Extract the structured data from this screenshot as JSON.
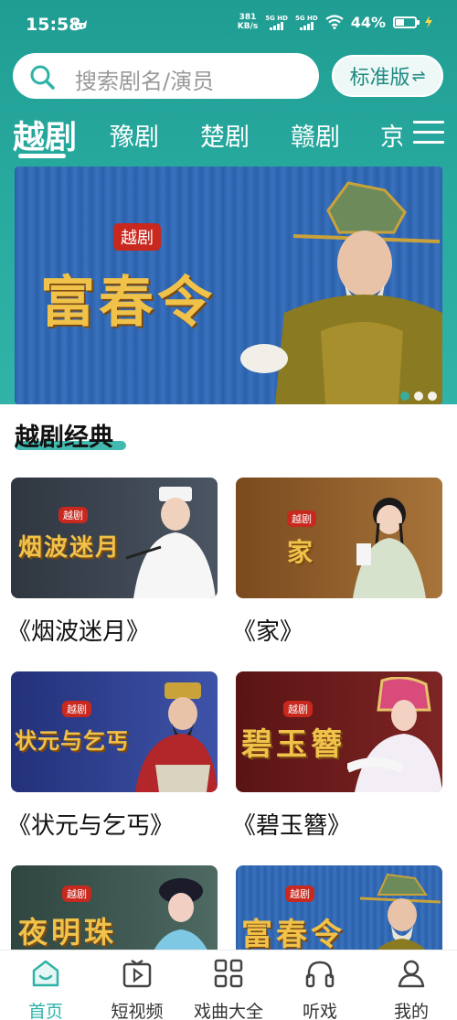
{
  "status_bar": {
    "time": "15:58",
    "net_speed_value": "381",
    "net_speed_unit": "KB/s",
    "signal1_label": "5G HD",
    "signal2_label": "5G HD",
    "battery_percent": "44%",
    "battery_level": 0.44
  },
  "search": {
    "placeholder": "搜索剧名/演员",
    "icon": "search-icon"
  },
  "edition_button": {
    "label": "标准版",
    "icon": "swap-icon"
  },
  "category_tabs": [
    {
      "label": "越剧",
      "active": true
    },
    {
      "label": "豫剧",
      "active": false
    },
    {
      "label": "楚剧",
      "active": false
    },
    {
      "label": "赣剧",
      "active": false
    },
    {
      "label": "京",
      "active": false
    }
  ],
  "banner": {
    "tag": "越剧",
    "title": "富春令",
    "dot_count": 3,
    "active_dot": 0
  },
  "section": {
    "title": "越剧经典"
  },
  "cards": [
    {
      "title": "《烟波迷月》",
      "tag": "越剧",
      "calligraphy": "烟波迷月",
      "bg": "#3c4450"
    },
    {
      "title": "《家》",
      "tag": "越剧",
      "calligraphy": "家",
      "bg": "#8a5a2a"
    },
    {
      "title": "《状元与乞丐》",
      "tag": "越剧",
      "calligraphy": "状元与乞丐",
      "bg": "#2e3f8c"
    },
    {
      "title": "《碧玉簪》",
      "tag": "越剧",
      "calligraphy": "碧玉簪",
      "bg": "#6a1b1b"
    },
    {
      "title": "",
      "tag": "越剧",
      "calligraphy": "夜明珠",
      "bg": "#35504a"
    },
    {
      "title": "",
      "tag": "越剧",
      "calligraphy": "富春令",
      "bg": "#2c5ea8"
    }
  ],
  "bottom_nav": [
    {
      "label": "首页",
      "icon": "home-icon",
      "active": true
    },
    {
      "label": "短视频",
      "icon": "video-icon",
      "active": false
    },
    {
      "label": "戏曲大全",
      "icon": "grid-icon",
      "active": false
    },
    {
      "label": "听戏",
      "icon": "headphones-icon",
      "active": false
    },
    {
      "label": "我的",
      "icon": "user-icon",
      "active": false
    }
  ],
  "colors": {
    "accent": "#2fb3a8",
    "header_top": "#1f9d93",
    "tag_red": "#c8281e",
    "calligraphy_gold": "#f0c24a"
  }
}
